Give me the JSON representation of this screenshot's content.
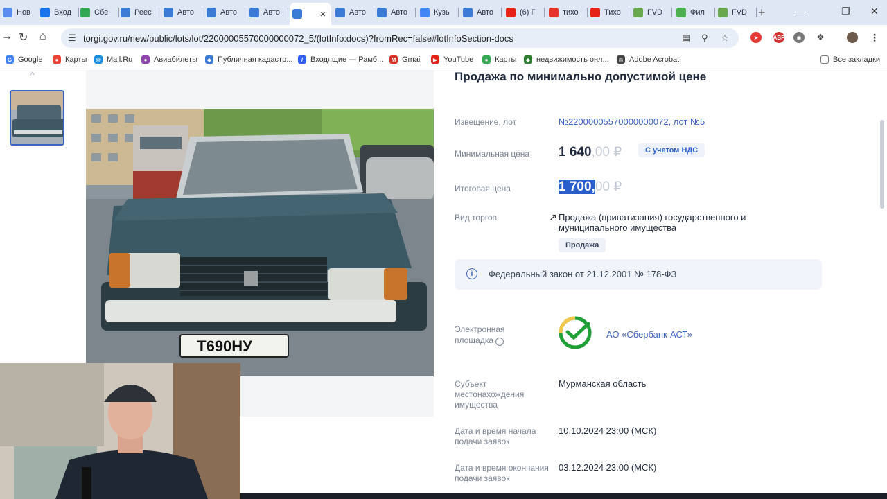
{
  "tabs": [
    {
      "label": "Нов",
      "icon": "browser-icon",
      "color": "#5b8def"
    },
    {
      "label": "Вход",
      "icon": "mail-icon",
      "color": "#1a73e8"
    },
    {
      "label": "Сбе",
      "icon": "chrome-icon",
      "color": "#34a853"
    },
    {
      "label": "Реес",
      "icon": "rosreestr-icon",
      "color": "#3b7bd6"
    },
    {
      "label": "Авто",
      "icon": "torgi-icon",
      "color": "#3b7bd6"
    },
    {
      "label": "Авто",
      "icon": "torgi-icon",
      "color": "#3b7bd6"
    },
    {
      "label": "Авто",
      "icon": "torgi-icon",
      "color": "#3b7bd6"
    },
    {
      "label": "",
      "icon": "torgi-icon",
      "color": "#3b7bd6",
      "active": true
    },
    {
      "label": "Авто",
      "icon": "torgi-icon",
      "color": "#3b7bd6"
    },
    {
      "label": "Авто",
      "icon": "torgi-icon",
      "color": "#3b7bd6"
    },
    {
      "label": "Кузь",
      "icon": "google-icon",
      "color": "#4285f4"
    },
    {
      "label": "Авто",
      "icon": "torgi-icon",
      "color": "#3b7bd6"
    },
    {
      "label": "(6) Г",
      "icon": "youtube-icon",
      "color": "#e62117"
    },
    {
      "label": "тихо",
      "icon": "yandex-icon",
      "color": "#e6332a"
    },
    {
      "label": "Тихо",
      "icon": "youtube-icon",
      "color": "#e62117"
    },
    {
      "label": "FVD",
      "icon": "fvd-icon",
      "color": "#6aa84f"
    },
    {
      "label": "Фил",
      "icon": "hd-icon",
      "color": "#4caf50"
    },
    {
      "label": "FVD",
      "icon": "fvd-icon",
      "color": "#6aa84f"
    }
  ],
  "address": {
    "url": "torgi.gov.ru/new/public/lots/lot/22000005570000000072_5/(lotInfo:docs)?fromRec=false#lotInfoSection-docs"
  },
  "bookmarks": [
    {
      "label": "Google",
      "color": "#4285f4",
      "glyph": "G"
    },
    {
      "label": "Карты",
      "color": "#ea4335",
      "glyph": "●"
    },
    {
      "label": "Mail.Ru",
      "color": "#168de2",
      "glyph": "@"
    },
    {
      "label": "Авиабилеты",
      "color": "#8e44ad",
      "glyph": "●"
    },
    {
      "label": "Публичная кадастр...",
      "color": "#3b7bd6",
      "glyph": "◆"
    },
    {
      "label": "Входящие — Рамб...",
      "color": "#315efb",
      "glyph": "/"
    },
    {
      "label": "Gmail",
      "color": "#d93025",
      "glyph": "M"
    },
    {
      "label": "YouTube",
      "color": "#e62117",
      "glyph": "▶"
    },
    {
      "label": "Карты",
      "color": "#34a853",
      "glyph": "●"
    },
    {
      "label": "недвижимость онл...",
      "color": "#2e7d32",
      "glyph": "◆"
    },
    {
      "label": "Adobe Acrobat",
      "color": "#444444",
      "glyph": "◎"
    }
  ],
  "all_bookmarks": "Все закладки",
  "lot": {
    "sale_type_title": "Продажа по минимально допустимой цене",
    "notice_label": "Извещение, лот",
    "notice_value": "№22000005570000000072, лот №5",
    "min_price_label": "Минимальная цена",
    "min_price_main": "1 640",
    "min_price_fraction": ",00 ₽",
    "vat_badge": "С учетом НДС",
    "final_price_label": "Итоговая цена",
    "final_price_main": "1 700,",
    "final_price_fraction": "00 ₽",
    "auction_type_label": "Вид торгов",
    "auction_type_line1": "Продажа (приватизация) государственного и",
    "auction_type_line2": "муниципального имущества",
    "auction_badge": "Продажа",
    "law_notice": "Федеральный закон от 21.12.2001 № 178-ФЗ",
    "platform_label_line1": "Электронная",
    "platform_label_line2": "площадка",
    "platform_value": "АО «Сбербанк-АСТ»",
    "region_label_line1": "Субъект",
    "region_label_line2": "местонахождения",
    "region_label_line3": "имущества",
    "region_value": "Мурманская область",
    "start_label_line1": "Дата и время начала",
    "start_label_line2": "подачи заявок",
    "start_value": "10.10.2024 23:00 (МСК)",
    "end_label_line1": "Дата и время окончания",
    "end_label_line2": "подачи заявок",
    "end_value": "03.12.2024 23:00 (МСК)"
  },
  "photo": {
    "plate": "Т690НУ"
  }
}
